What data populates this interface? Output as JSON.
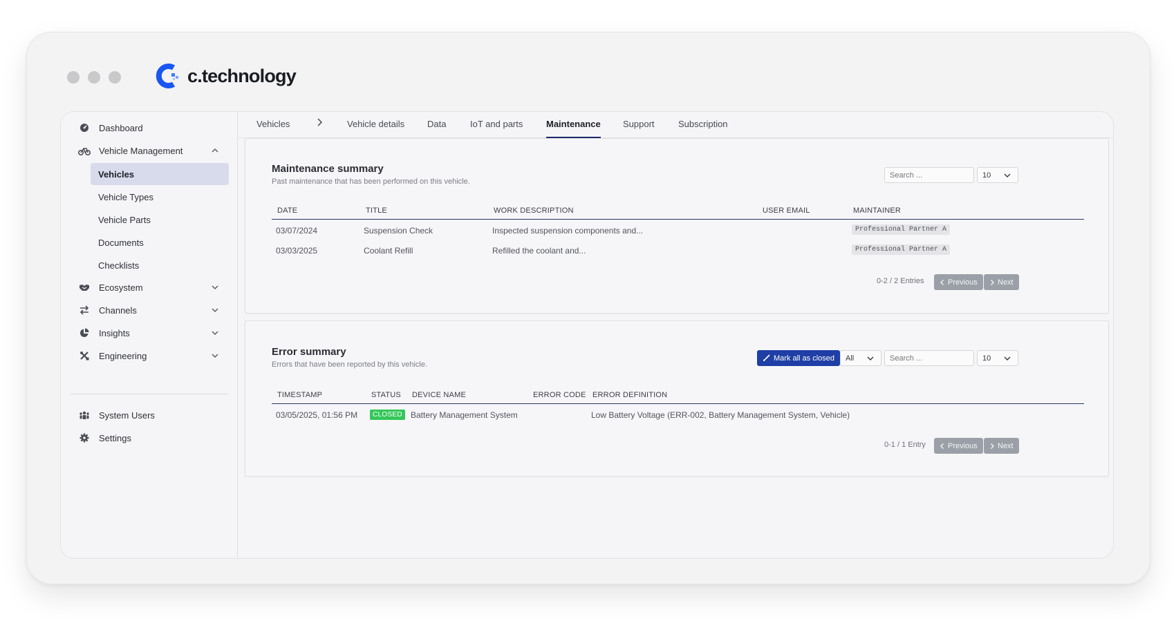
{
  "brand": {
    "name": "c.technology"
  },
  "sidebar": {
    "items": [
      {
        "label": "Dashboard",
        "icon": "dashboard-icon"
      },
      {
        "label": "Vehicle Management",
        "icon": "bike-icon",
        "expanded": true
      },
      {
        "label": "Ecosystem",
        "icon": "handshake-icon"
      },
      {
        "label": "Channels",
        "icon": "arrows-exchange-icon"
      },
      {
        "label": "Insights",
        "icon": "pie-chart-icon"
      },
      {
        "label": "Engineering",
        "icon": "tools-icon"
      },
      {
        "label": "System Users",
        "icon": "users-icon"
      },
      {
        "label": "Settings",
        "icon": "gear-icon"
      }
    ],
    "sub_items": [
      "Vehicles",
      "Vehicle Types",
      "Vehicle Parts",
      "Documents",
      "Checklists"
    ],
    "active_sub": "Vehicles"
  },
  "tabs": {
    "items": [
      "Vehicles",
      "Vehicle details",
      "Data",
      "IoT and parts",
      "Maintenance",
      "Support",
      "Subscription"
    ],
    "active": "Maintenance"
  },
  "maintenance": {
    "title": "Maintenance summary",
    "subtitle": "Past maintenance that has been performed on this vehicle.",
    "search_placeholder": "Search ...",
    "page_size": "10",
    "columns": [
      "DATE",
      "TITLE",
      "WORK DESCRIPTION",
      "USER EMAIL",
      "MAINTAINER"
    ],
    "rows": [
      {
        "date": "03/07/2024",
        "title": "Suspension Check",
        "description": "Inspected suspension components and...",
        "email": "",
        "maintainer": "Professional Partner A"
      },
      {
        "date": "03/03/2025",
        "title": "Coolant Refill",
        "description": "Refilled the coolant and...",
        "email": "",
        "maintainer": "Professional Partner A"
      }
    ],
    "entries": "0-2 / 2 Entries",
    "prev_label": "Previous",
    "next_label": "Next"
  },
  "errors": {
    "title": "Error summary",
    "subtitle": "Errors that have been reported by this vehicle.",
    "mark_closed_label": "Mark all as closed",
    "filter_value": "All",
    "search_placeholder": "Search ...",
    "page_size": "10",
    "columns": [
      "TIMESTAMP",
      "STATUS",
      "DEVICE NAME",
      "ERROR CODE",
      "ERROR DEFINITION"
    ],
    "rows": [
      {
        "timestamp": "03/05/2025, 01:56 PM",
        "status": "CLOSED",
        "device": "Battery Management System",
        "code": "",
        "definition": "Low Battery Voltage (ERR-002, Battery Management System, Vehicle)"
      }
    ],
    "entries": "0-1 / 1 Entry",
    "prev_label": "Previous",
    "next_label": "Next"
  },
  "colors": {
    "brand_blue": "#1a56f0",
    "nav_active_bg": "#d8dbeb",
    "primary_button": "#1f3fa6",
    "status_closed": "#34c759",
    "pager_button": "#9ba0a8"
  }
}
